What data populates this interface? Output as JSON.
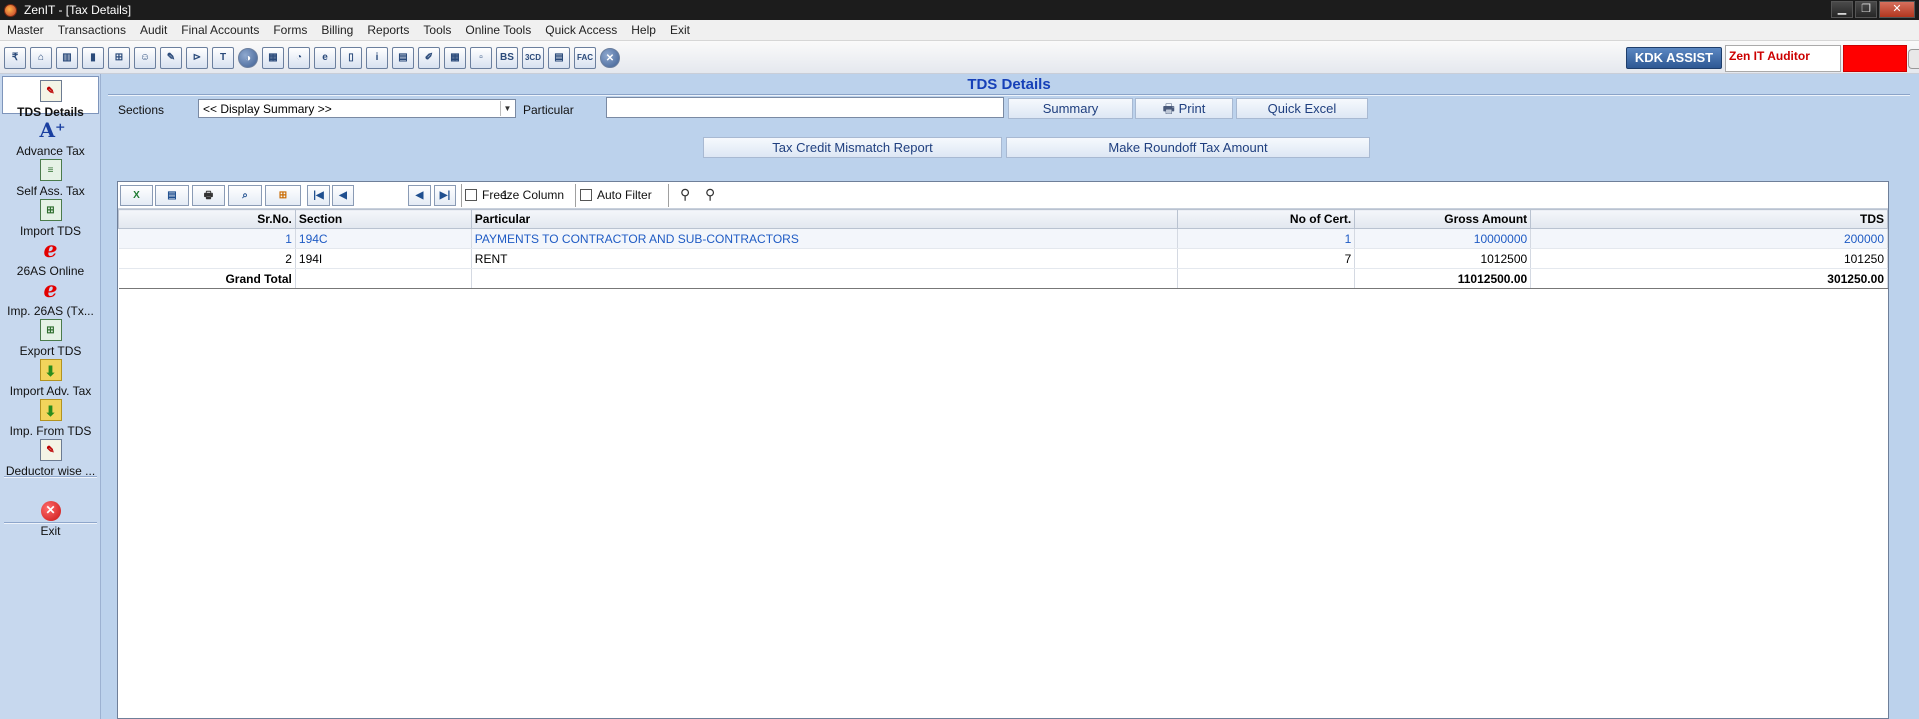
{
  "window": {
    "title": "ZenIT - [Tax Details]"
  },
  "menu": [
    "Master",
    "Transactions",
    "Audit",
    "Final Accounts",
    "Forms",
    "Billing",
    "Reports",
    "Tools",
    "Online Tools",
    "Quick Access",
    "Help",
    "Exit"
  ],
  "toolbar": {
    "icons": [
      "rupee-icon",
      "home-icon",
      "buildings-icon",
      "bar-chart-icon",
      "gift-icon",
      "users-icon",
      "pin-icon",
      "filter-icon",
      "tax-icon",
      "toggle-icon",
      "calculator-icon",
      "pie-chart-icon",
      "pay-icon",
      "book-icon",
      "info-icon",
      "report-icon",
      "edit-report-icon",
      "calendar-icon",
      "folder-icon",
      "balance-sheet-icon",
      "3cd-icon",
      "form-icon",
      "fac-icon",
      "close-circle-icon"
    ],
    "icon_texts": [
      "₹",
      "⌂",
      "▥",
      "▮",
      "⊞",
      "☺",
      "✎",
      "⊳",
      "T",
      "◑",
      "▦",
      "◔",
      "e",
      "▯",
      "i",
      "▤",
      "✐",
      "▦",
      "▫",
      "BS",
      "3CD",
      "▤",
      "FAC",
      "✕"
    ],
    "kdk_assist": "KDK ASSIST",
    "auditor": "Zen IT Auditor"
  },
  "sidebar": [
    {
      "label": "TDS Details",
      "icon": "tax-pad-icon",
      "glyph": "✎",
      "active": true
    },
    {
      "label": "Advance Tax",
      "icon": "advance-tax-icon",
      "glyph": "A⁺",
      "active": false
    },
    {
      "label": "Self Ass. Tax",
      "icon": "self-assessment-icon",
      "glyph": "≡",
      "active": false
    },
    {
      "label": "Import TDS",
      "icon": "import-sheet-icon",
      "glyph": "⊞",
      "active": false
    },
    {
      "label": "26AS Online",
      "icon": "e-icon",
      "glyph": "e",
      "active": false
    },
    {
      "label": "Imp. 26AS (Tx...",
      "icon": "e-icon",
      "glyph": "e",
      "active": false
    },
    {
      "label": "Export TDS",
      "icon": "export-sheet-icon",
      "glyph": "⊞",
      "active": false
    },
    {
      "label": "Import Adv. Tax",
      "icon": "folder-import-icon",
      "glyph": "⬇",
      "active": false
    },
    {
      "label": "Imp. From TDS",
      "icon": "folder-import-icon",
      "glyph": "⬇",
      "active": false
    },
    {
      "label": "Deductor wise ...",
      "icon": "deductor-pad-icon",
      "glyph": "✎",
      "active": false
    },
    {
      "label": "Exit",
      "icon": "exit-icon",
      "glyph": "✕",
      "active": false
    }
  ],
  "main": {
    "title": "TDS Details",
    "sections_label": "Sections",
    "sections_value": "<< Display Summary >>",
    "particular_label": "Particular",
    "particular_value": "",
    "summary_btn": "Summary",
    "print_btn": "Print",
    "quick_excel_btn": "Quick Excel",
    "mismatch_btn": "Tax Credit Mismatch Report",
    "roundoff_btn": "Make Roundoff Tax Amount"
  },
  "grid": {
    "page": "1",
    "freeze_column": "Freeze Column",
    "auto_filter": "Auto Filter",
    "columns": [
      "Sr.No.",
      "Section",
      "Particular",
      "No of Cert.",
      "Gross Amount",
      "TDS"
    ],
    "rows": [
      {
        "sr": "1",
        "section": "194C",
        "particular": "PAYMENTS TO CONTRACTOR AND SUB-CONTRACTORS",
        "certs": "1",
        "gross": "10000000",
        "tds": "200000"
      },
      {
        "sr": "2",
        "section": "194I",
        "particular": "RENT",
        "certs": "7",
        "gross": "1012500",
        "tds": "101250"
      }
    ],
    "total": {
      "label": "Grand Total",
      "gross": "11012500.00",
      "tds": "301250.00"
    }
  },
  "colors": {
    "accent": "#1640b8",
    "sidebar_bg": "#c7d8ee",
    "window_bg": "#bcd2ec",
    "red_box": "#ff0000"
  }
}
